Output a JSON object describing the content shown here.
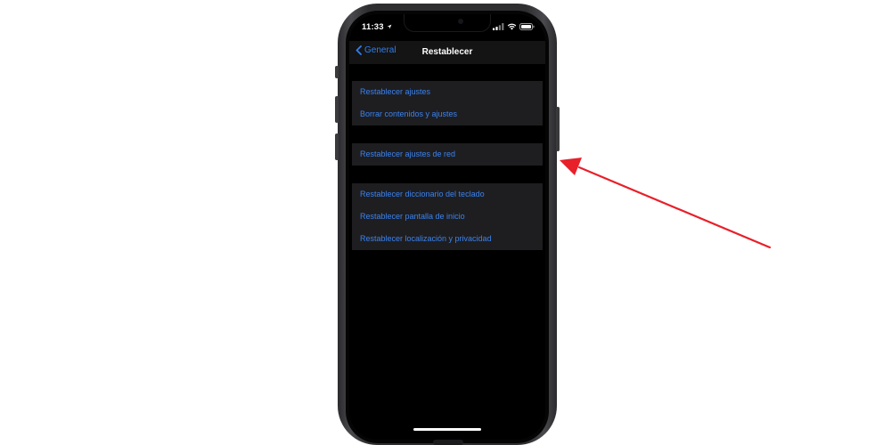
{
  "status_bar": {
    "time": "11:33"
  },
  "nav": {
    "back_label": "General",
    "title": "Restablecer"
  },
  "groups": [
    {
      "items": [
        {
          "label": "Restablecer ajustes"
        },
        {
          "label": "Borrar contenidos y ajustes"
        }
      ]
    },
    {
      "items": [
        {
          "label": "Restablecer ajustes de red"
        }
      ]
    },
    {
      "items": [
        {
          "label": "Restablecer diccionario del teclado"
        },
        {
          "label": "Restablecer pantalla de inicio"
        },
        {
          "label": "Restablecer localización y privacidad"
        }
      ]
    }
  ],
  "colors": {
    "accent_blue": "#3b82f0",
    "arrow_red": "#e8202a",
    "group_bg": "#1e1e20",
    "screen_bg": "#000000"
  },
  "icons": [
    "location-arrow-icon",
    "signal-bars-icon",
    "wifi-icon",
    "battery-icon",
    "chevron-left-icon",
    "red-arrow-annotation"
  ]
}
